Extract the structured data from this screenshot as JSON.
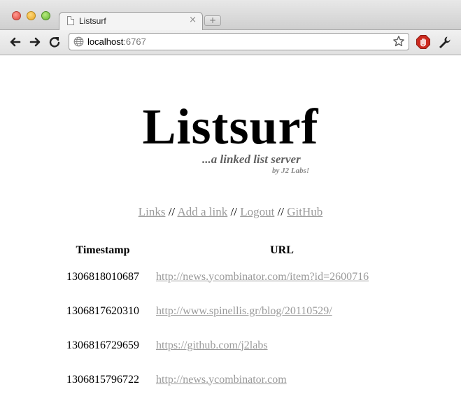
{
  "browser": {
    "tab_title": "Listsurf",
    "tab_close": "×",
    "new_tab": "+",
    "url_host": "localhost",
    "url_port": ":6767"
  },
  "site": {
    "title": "Listsurf",
    "tagline": "...a linked list server",
    "byline": "by J2 Labs!"
  },
  "nav": {
    "links": [
      "Links",
      "Add a link",
      "Logout",
      "GitHub"
    ],
    "separator": "//"
  },
  "table": {
    "headers": [
      "Timestamp",
      "URL"
    ],
    "rows": [
      {
        "timestamp": "1306818010687",
        "url": "http://news.ycombinator.com/item?id=2600716"
      },
      {
        "timestamp": "1306817620310",
        "url": "http://www.spinellis.gr/blog/20110529/"
      },
      {
        "timestamp": "1306816729659",
        "url": "https://github.com/j2labs"
      },
      {
        "timestamp": "1306815796722",
        "url": "http://news.ycombinator.com"
      }
    ]
  },
  "colors": {
    "link": "#9a9a9a",
    "tagline": "#606060",
    "byline": "#8a8a8a",
    "close_button": "#e0443a",
    "minimize_button": "#e8a625",
    "zoom_button": "#62b531",
    "stop_extension": "#cc2a1f"
  },
  "icons": {
    "back": "back-arrow-icon",
    "forward": "forward-arrow-icon",
    "reload": "reload-icon",
    "page": "page-icon",
    "globe": "globe-icon",
    "star": "star-icon",
    "extension": "stop-hand-icon",
    "settings": "wrench-icon"
  }
}
